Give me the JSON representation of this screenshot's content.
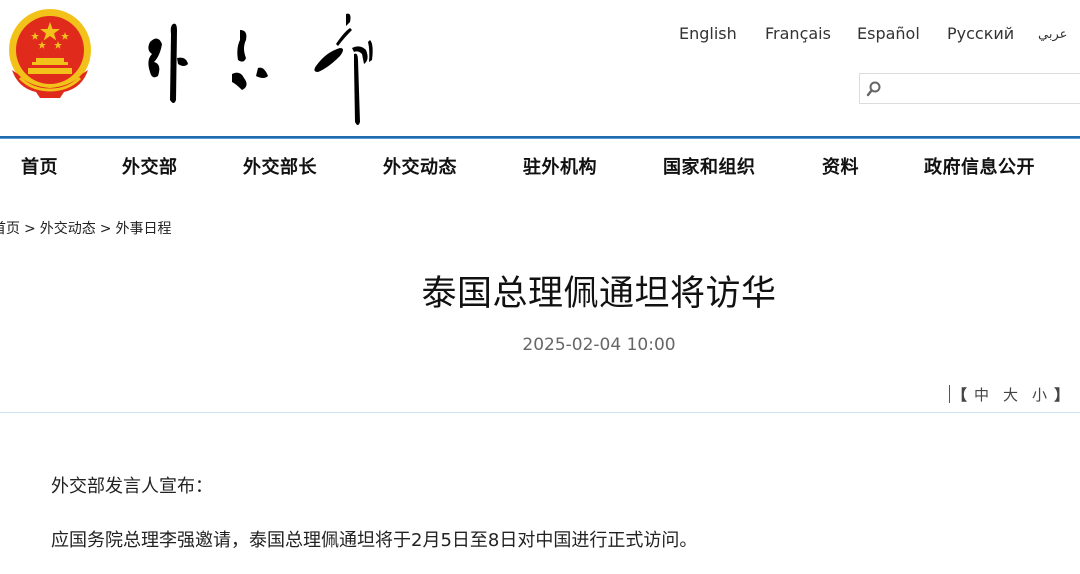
{
  "header": {
    "emblem_icon": "national-emblem-icon",
    "logo_text": "外交部",
    "logo_style": "calligraphy",
    "colors": {
      "emblem_red": "#e02a1c",
      "emblem_gold": "#f2c21a",
      "accent_blue": "#1f6aae"
    }
  },
  "languages": [
    {
      "label": "English"
    },
    {
      "label": "Français"
    },
    {
      "label": "Español"
    },
    {
      "label": "Русский"
    },
    {
      "label": "عربي"
    }
  ],
  "search": {
    "icon": "search-icon",
    "value": "",
    "placeholder": ""
  },
  "nav": {
    "items": [
      {
        "label": "首页"
      },
      {
        "label": "外交部"
      },
      {
        "label": "外交部长"
      },
      {
        "label": "外交动态"
      },
      {
        "label": "驻外机构"
      },
      {
        "label": "国家和组织"
      },
      {
        "label": "资料"
      },
      {
        "label": "政府信息公开"
      }
    ]
  },
  "breadcrumb": {
    "items": [
      {
        "label": "首页"
      },
      {
        "label": "外交动态"
      },
      {
        "label": "外事日程"
      }
    ],
    "separator": ">"
  },
  "article": {
    "title": "泰国总理佩通坦将访华",
    "date": "2025-02-04 10:00",
    "font_size_controls": {
      "open_bracket": "【",
      "medium": "中",
      "large": "大",
      "small": "小",
      "close_bracket": "】"
    },
    "paragraphs": [
      "外交部发言人宣布：",
      "应国务院总理李强邀请，泰国总理佩通坦将于2月5日至8日对中国进行正式访问。"
    ]
  }
}
